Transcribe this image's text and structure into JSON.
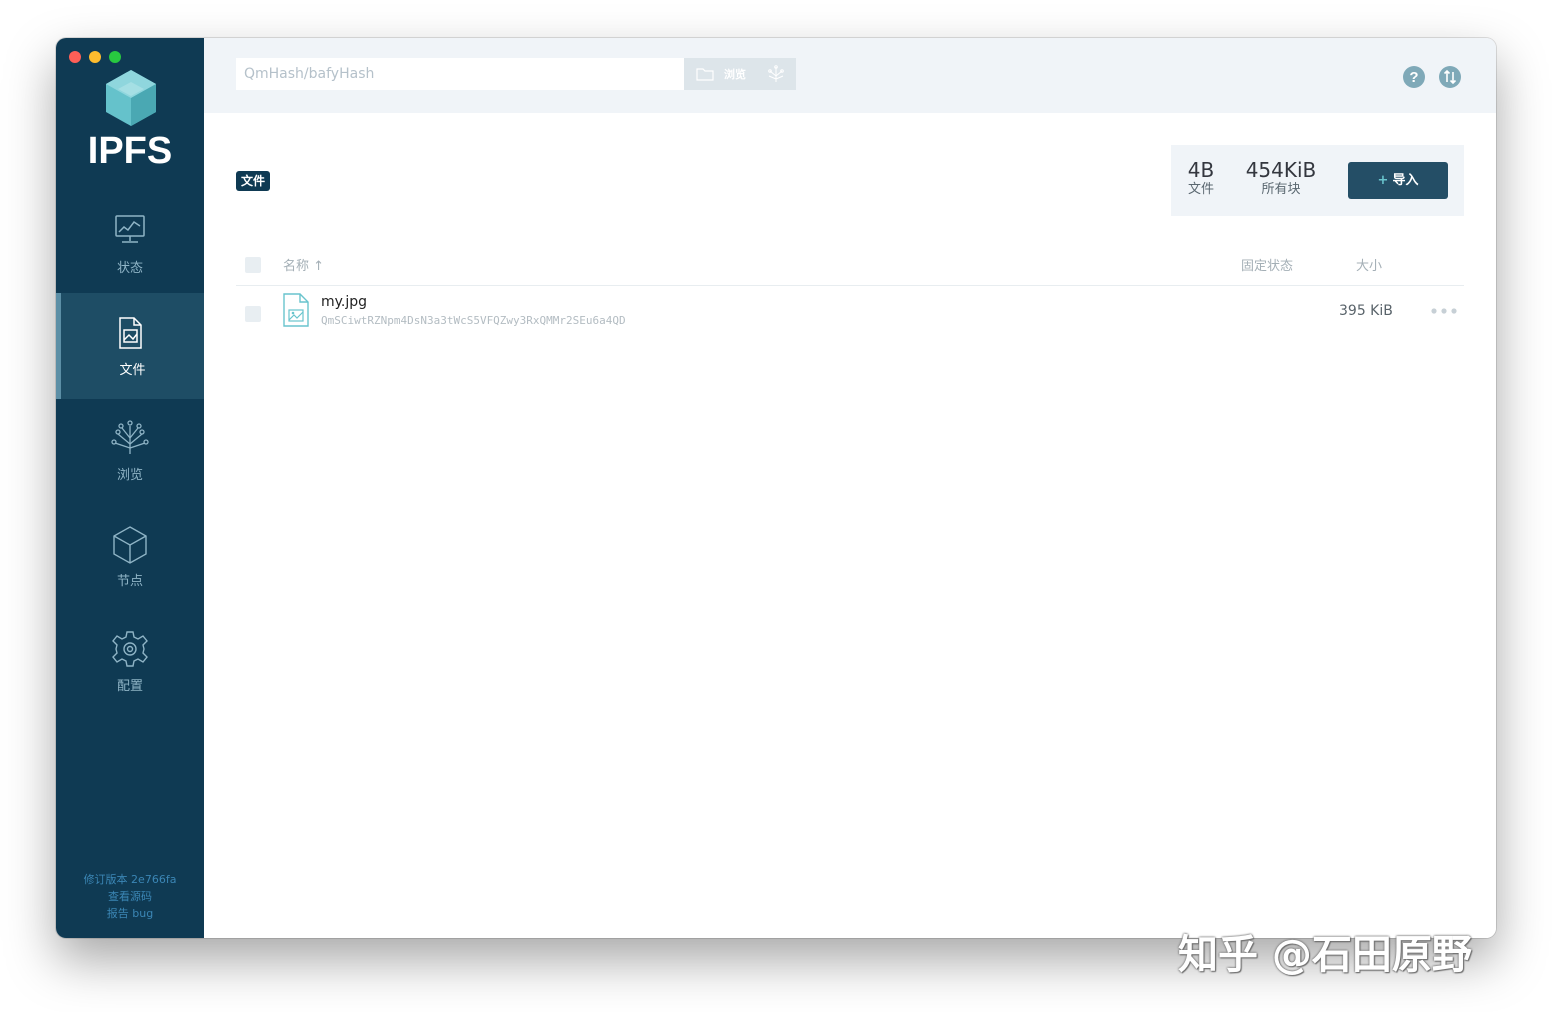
{
  "app": {
    "name": "IPFS"
  },
  "sidebar": {
    "items": [
      {
        "label": "状态",
        "icon": "status-chart-icon"
      },
      {
        "label": "文件",
        "icon": "files-icon",
        "active": true
      },
      {
        "label": "浏览",
        "icon": "explore-tree-icon"
      },
      {
        "label": "节点",
        "icon": "peers-cube-icon"
      },
      {
        "label": "配置",
        "icon": "settings-gear-icon"
      }
    ],
    "footer": {
      "revision": "修订版本 2e766fa",
      "source": "查看源码",
      "bug": "报告 bug"
    }
  },
  "topbar": {
    "search_placeholder": "QmHash/bafyHash",
    "browse_label": "浏览"
  },
  "files": {
    "badge": "文件",
    "stats": {
      "files_count": "4B",
      "files_label": "文件",
      "blocks_size": "454KiB",
      "blocks_label": "所有块"
    },
    "import_plus": "+",
    "import_label": "导入",
    "columns": {
      "name": "名称 ↑",
      "pin_status": "固定状态",
      "size": "大小"
    },
    "rows": [
      {
        "name": "my.jpg",
        "hash": "QmSCiwtRZNpm4DsN3a3tWcS5VFQZwy3RxQMMr2SEu6a4QD",
        "size": "395 KiB"
      }
    ]
  },
  "watermark": "知乎 @石田原野",
  "colors": {
    "sidebar": "#0f3a53",
    "sidebar_active": "#1e4d65",
    "accent": "#69c4cd",
    "topbar": "#f0f4f8"
  }
}
